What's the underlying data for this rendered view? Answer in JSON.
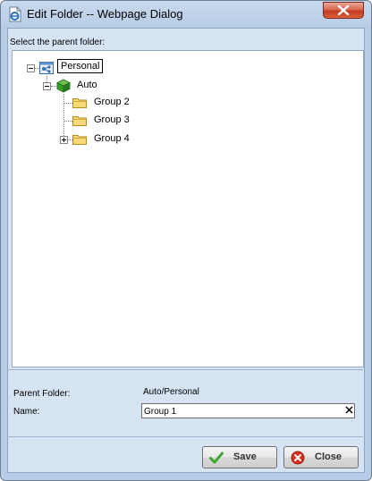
{
  "window": {
    "title": "Edit Folder -- Webpage Dialog"
  },
  "tree": {
    "prompt": "Select the parent folder:",
    "root": "Personal",
    "child": "Auto",
    "groups": [
      "Group 2",
      "Group 3",
      "Group 4"
    ]
  },
  "form": {
    "parent_label": "Parent Folder:",
    "parent_value": "Auto/Personal",
    "name_label": "Name:",
    "name_value": "Group 1"
  },
  "buttons": {
    "save": "Save",
    "close": "Close"
  },
  "colors": {
    "save_icon": "#3ea92f",
    "close_icon": "#d8321c",
    "folder": "#f3c94d"
  }
}
